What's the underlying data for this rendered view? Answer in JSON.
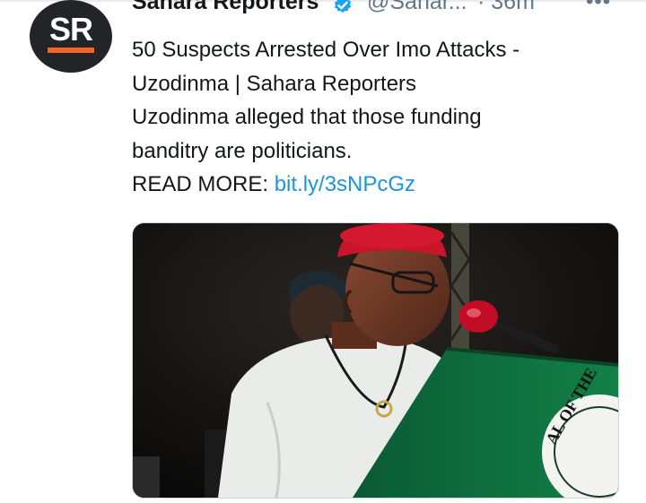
{
  "tweet": {
    "account_name": "Sahara Reporters",
    "handle": "@Sahar...",
    "time": "· 36m",
    "more_label": "•••",
    "avatar_text": "SR",
    "lines": [
      "50 Suspects Arrested Over Imo Attacks -",
      "Uzodinma | Sahara Reporters",
      "Uzodinma alleged that those funding",
      "banditry are politicians."
    ],
    "read_more_label": "READ MORE: ",
    "link_text": "bit.ly/3sNPcGz",
    "seal_text": "AL OF THE"
  },
  "colors": {
    "brand_orange": "#f26522",
    "verified_blue": "#1da1f2",
    "link_blue": "#1b95e0",
    "muted_gray": "#657786",
    "podium_green": "#0f6b3f",
    "cap_red": "#c8152a"
  },
  "icons": {
    "verified": "verified-badge-icon",
    "more": "more-options-icon"
  }
}
